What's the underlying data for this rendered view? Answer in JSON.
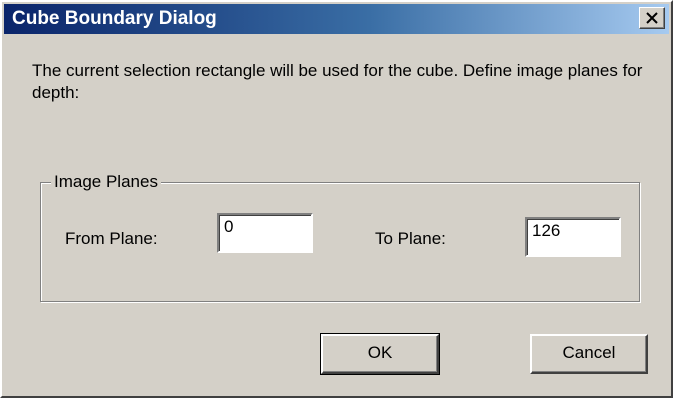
{
  "window": {
    "title": "Cube Boundary Dialog"
  },
  "message": "The current selection rectangle will be used for the cube. Define image planes for depth:",
  "image_planes": {
    "group_label": "Image Planes",
    "from_label": "From Plane:",
    "from_value": "0",
    "to_label": "To Plane:",
    "to_value": "126"
  },
  "buttons": {
    "ok": "OK",
    "cancel": "Cancel"
  },
  "icons": {
    "close": "close-icon"
  },
  "colors": {
    "face": "#d4d0c8",
    "title_start": "#0a246a",
    "title_end": "#a6caf0"
  }
}
